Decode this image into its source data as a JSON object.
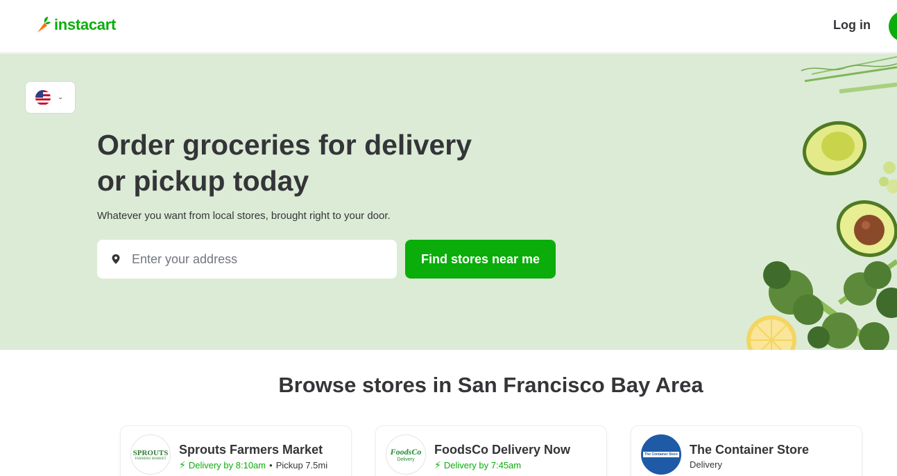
{
  "header": {
    "logo_text": "instacart",
    "login_label": "Log in"
  },
  "hero": {
    "language_selector": "US flag",
    "title_line1": "Order groceries for delivery",
    "title_line2": "or pickup today",
    "subtitle": "Whatever you want from local stores, brought right to your door.",
    "address_placeholder": "Enter your address",
    "find_button_label": "Find stores near me"
  },
  "browse": {
    "title": "Browse stores in San Francisco Bay Area"
  },
  "stores": [
    {
      "name": "Sprouts Farmers Market",
      "logo_text": "SPROUTS",
      "logo_sub": "FARMERS MARKET",
      "delivery": "Delivery by 8:10am",
      "separator": "•",
      "pickup": "Pickup 7.5mi"
    },
    {
      "name": "FoodsCo Delivery Now",
      "logo_text": "FoodsCo",
      "logo_sub": "Delivery",
      "delivery": "Delivery by 7:45am"
    },
    {
      "name": "The Container Store",
      "logo_text": "The Container Store",
      "meta": "Delivery"
    }
  ],
  "colors": {
    "brand": "#0aad0a",
    "hero_bg": "#dcebd6",
    "text": "#343538"
  }
}
